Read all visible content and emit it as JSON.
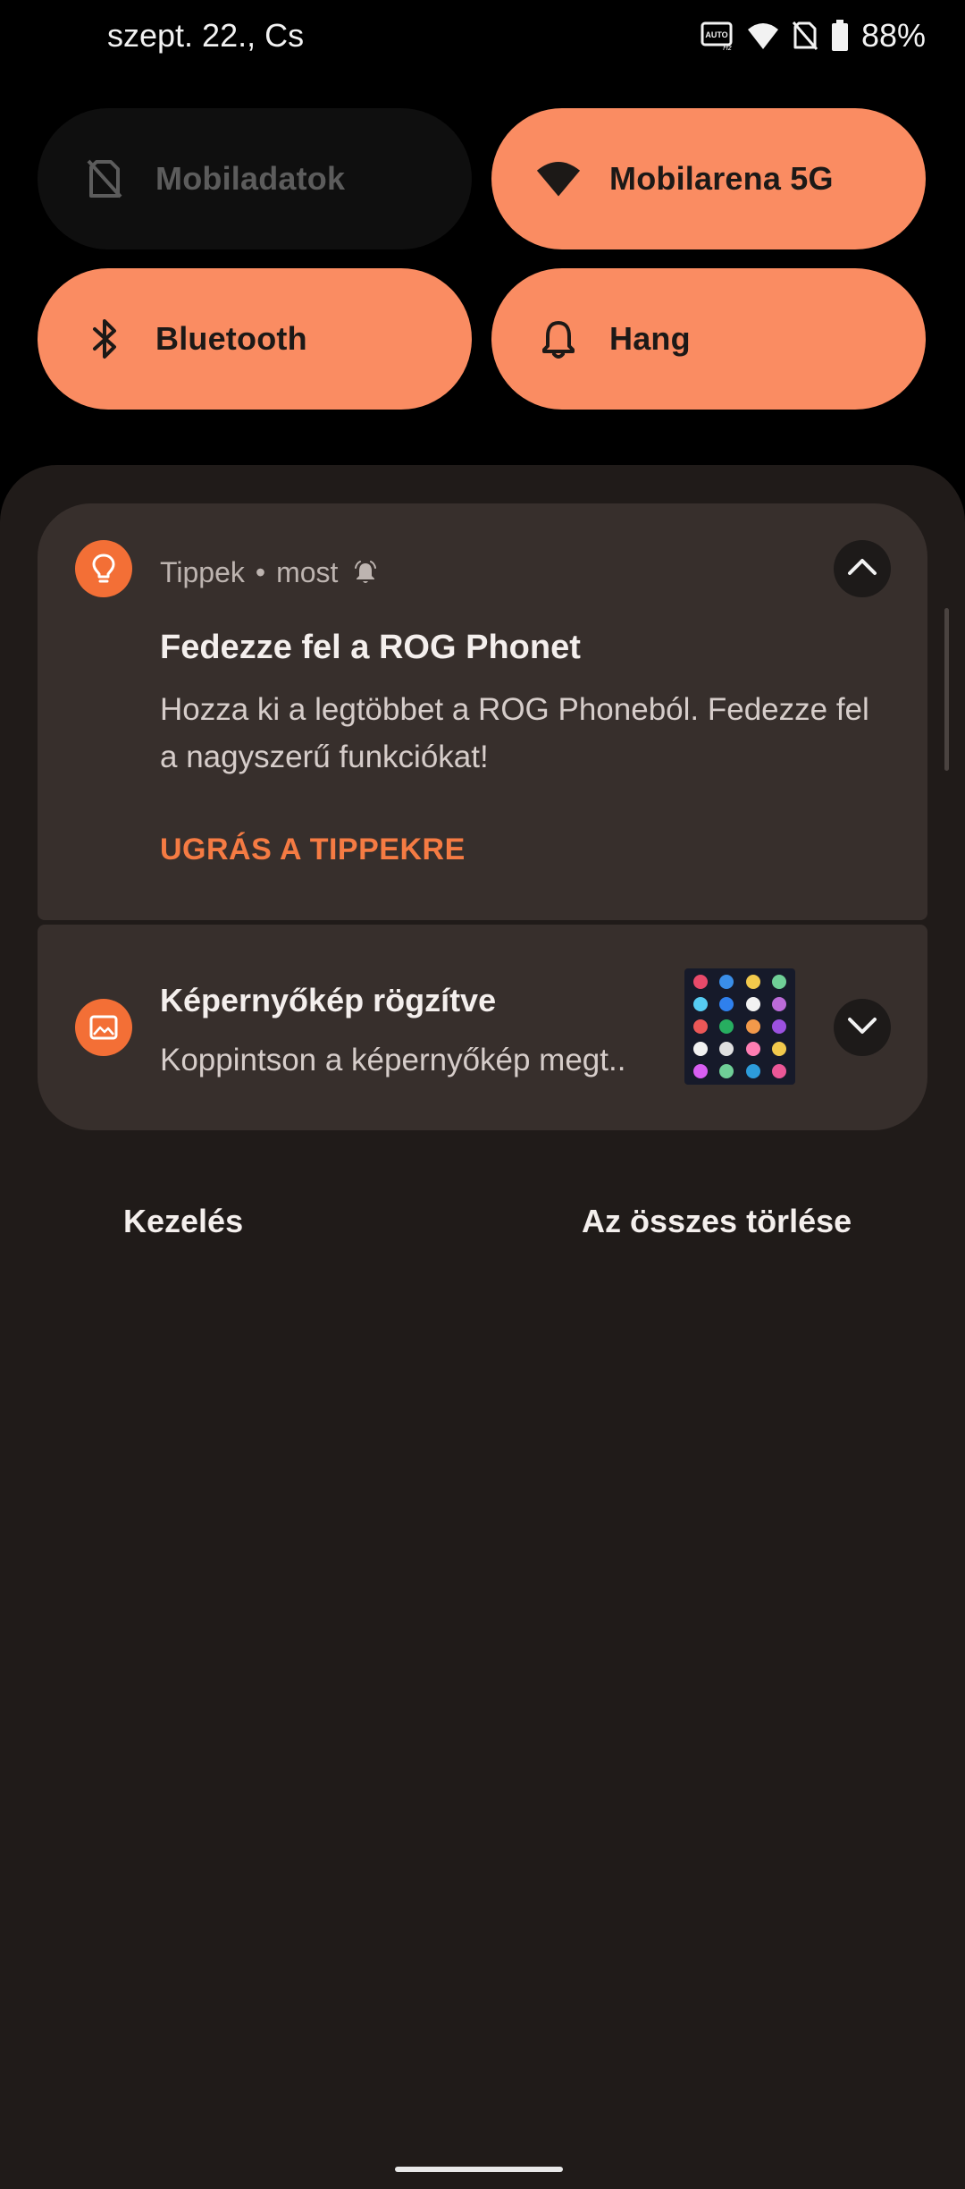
{
  "status_bar": {
    "date": "szept. 22., Cs",
    "battery": "88%",
    "icons": [
      "auto-refresh-rate-icon",
      "wifi-icon",
      "no-sim-icon",
      "battery-icon"
    ]
  },
  "quick_settings": {
    "tiles": [
      {
        "label": "Mobiladatok",
        "icon": "no-sim-icon",
        "active": false
      },
      {
        "label": "Mobilarena 5G",
        "icon": "wifi-icon",
        "active": true
      },
      {
        "label": "Bluetooth",
        "icon": "bluetooth-icon",
        "active": true
      },
      {
        "label": "Hang",
        "icon": "bell-icon",
        "active": true
      }
    ]
  },
  "notifications": [
    {
      "app": "Tippek",
      "time": "most",
      "icon": "lightbulb-icon",
      "title": "Fedezze fel a ROG Phonet",
      "body_line1": "Hozza ki a legtöbbet a ROG Phoneból. Fedezze fel",
      "body_line2": "a nagyszerű funkciókat!",
      "action": "UGRÁS A TIPPEKRE",
      "expanded": true
    },
    {
      "icon": "image-icon",
      "title": "Képernyőkép rögzítve",
      "body": "Koppintson a képernyőkép megt..",
      "expanded": false
    }
  ],
  "footer": {
    "manage": "Kezelés",
    "clear_all": "Az összes törlése"
  },
  "colors": {
    "accent": "#fa8c62",
    "app_icon": "#f36f36",
    "action": "#f57b43",
    "shade": "#201b19",
    "card": "#372f2c"
  }
}
